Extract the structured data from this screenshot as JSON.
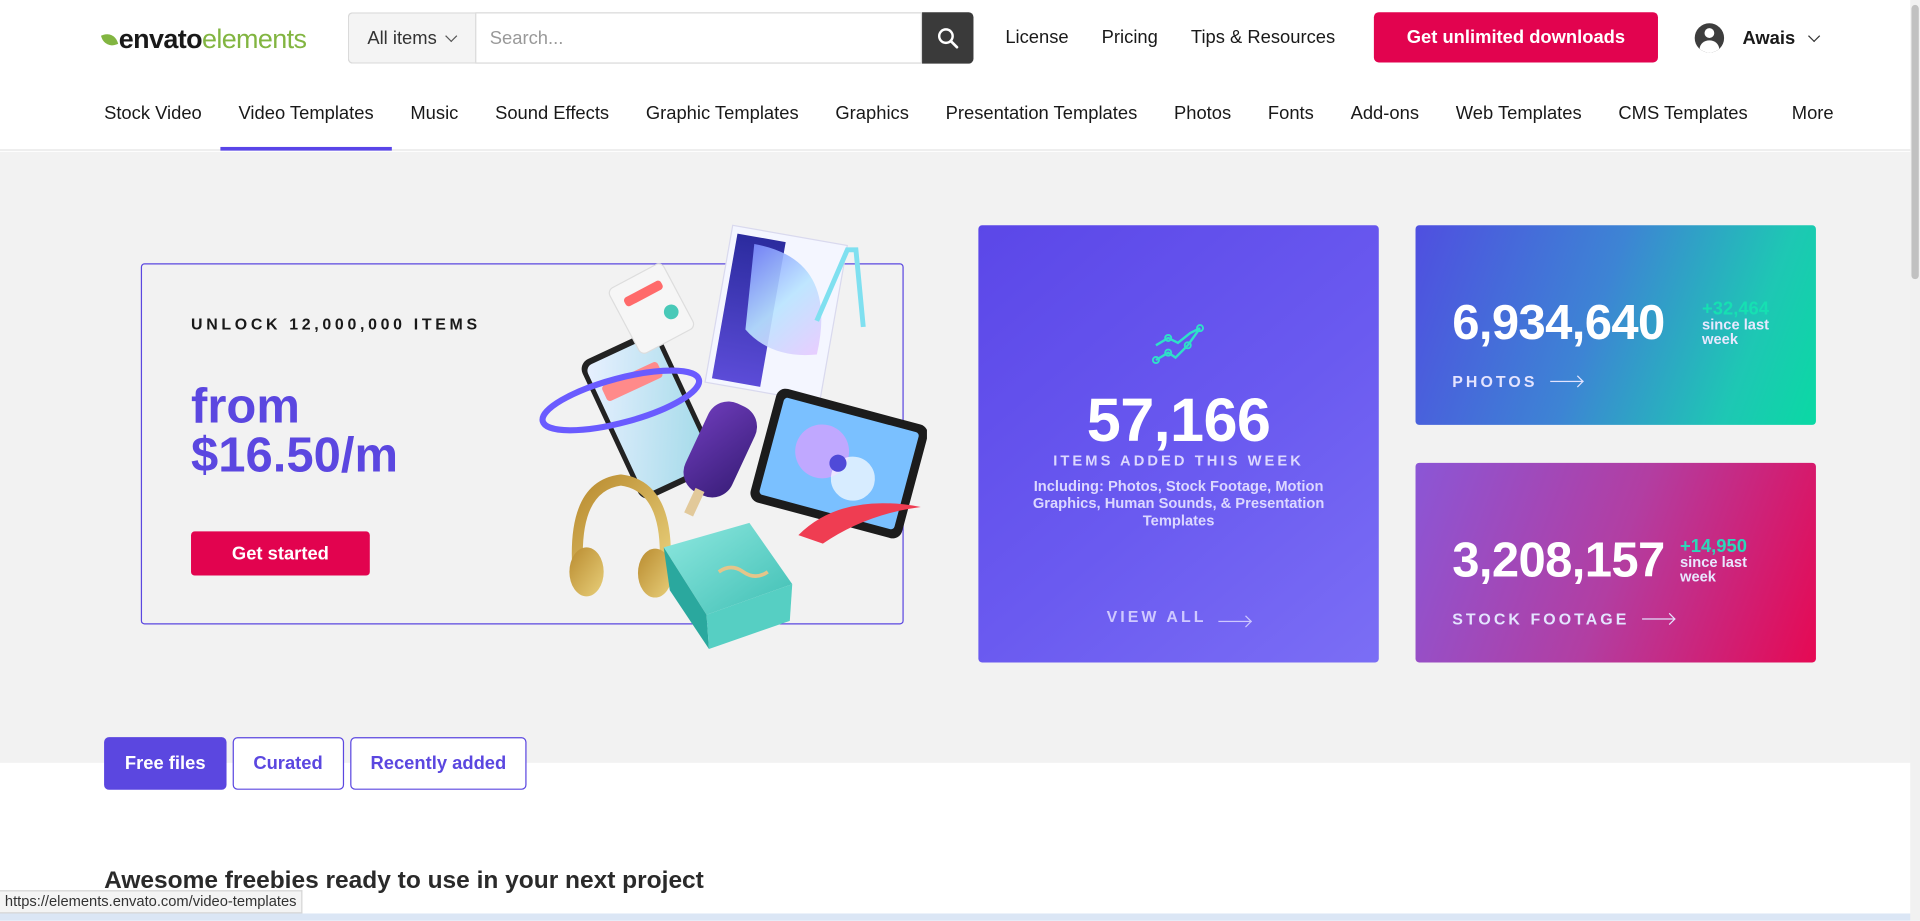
{
  "header": {
    "logo_part1": "envato",
    "logo_part2": "elements",
    "search": {
      "category": "All items",
      "placeholder": "Search..."
    },
    "links": [
      "License",
      "Pricing",
      "Tips & Resources"
    ],
    "cta": "Get unlimited downloads",
    "user_name": "Awais"
  },
  "nav": {
    "tabs": [
      "Stock Video",
      "Video Templates",
      "Music",
      "Sound Effects",
      "Graphic Templates",
      "Graphics",
      "Presentation Templates",
      "Photos",
      "Fonts",
      "Add-ons",
      "Web Templates",
      "CMS Templates",
      "More"
    ],
    "active_index": 1
  },
  "promo": {
    "kicker": "UNLOCK 12,000,000 ITEMS",
    "price": "from $16.50/m",
    "button": "Get started"
  },
  "weekly": {
    "count": "57,166",
    "label": "ITEMS ADDED THIS WEEK",
    "description": "Including: Photos, Stock Footage, Motion Graphics, Human Sounds, & Presentation Templates",
    "link": "VIEW ALL"
  },
  "stats": {
    "photos": {
      "count": "6,934,640",
      "delta": "+32,464",
      "since": "since last week",
      "caption": "PHOTOS"
    },
    "footage": {
      "count": "3,208,157",
      "delta": "+14,950",
      "since": "since last week",
      "caption": "STOCK FOOTAGE"
    }
  },
  "filters": {
    "buttons": [
      "Free files",
      "Curated",
      "Recently added"
    ],
    "active_index": 0
  },
  "section_title": "Awesome freebies ready to use in your next project",
  "status_url": "https://elements.envato.com/video-templates",
  "colors": {
    "brand_purple": "#5b47e0",
    "cta_red": "#e2034f",
    "logo_green": "#82b541"
  },
  "icons": [
    "search-icon",
    "chevron-down-icon",
    "user-avatar-icon",
    "trend-chart-icon",
    "arrow-right-icon"
  ]
}
